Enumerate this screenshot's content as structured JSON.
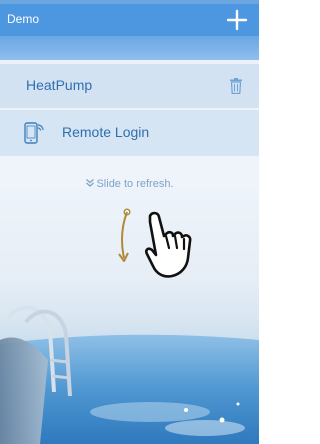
{
  "header": {
    "title": "Demo",
    "add_icon": "plus-icon"
  },
  "devices": [
    {
      "name": "HeatPump",
      "delete_icon": "trash-icon"
    }
  ],
  "remote_login": {
    "label": "Remote Login",
    "icon": "phone-wifi-icon"
  },
  "refresh": {
    "hint": "Slide to refresh.",
    "icon": "double-chevron-down-icon",
    "gesture_icon": "pull-down-hand-icon"
  },
  "colors": {
    "accent": "#4d97e0",
    "label": "#2f6fae",
    "hint": "#7fa4c9"
  }
}
